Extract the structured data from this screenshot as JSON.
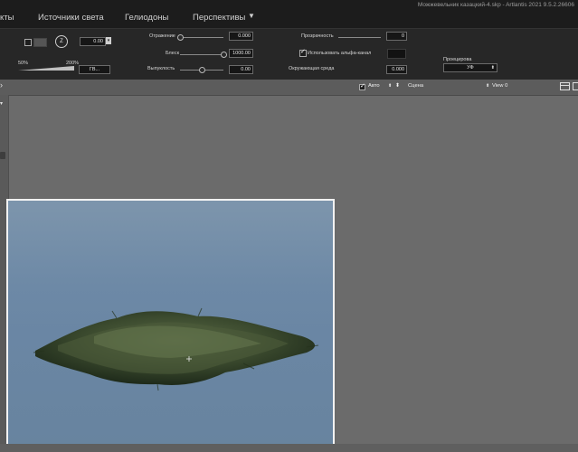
{
  "app": {
    "title": "Можжевельник казацкий-4.skp - Artlantis 2021 9.5.2.26606"
  },
  "menu": {
    "tabs": [
      {
        "label": "кты"
      },
      {
        "label": "Источники света"
      },
      {
        "label": "Гелиодоны"
      },
      {
        "label": "Перспективы"
      }
    ],
    "dropdown_glyph": "▼"
  },
  "panel": {
    "focal_letter": "Z",
    "focal_value": "0.00",
    "scale_min": "50%",
    "scale_max": "200%",
    "scale_button": "ГВ...",
    "reflection": {
      "label": "Отражение",
      "value": "0.000",
      "level": 0.0
    },
    "shine": {
      "label": "Блеск",
      "value": "1000.00",
      "level": 1.0
    },
    "bump": {
      "label": "Выпуклость",
      "value": "0.00",
      "level": 0.5
    },
    "transparency": {
      "label": "Прозрачность",
      "value": "0"
    },
    "alpha": {
      "label": "Использовать альфа-канал",
      "checked": true
    },
    "environment": {
      "label": "Окружающая среда",
      "value": "0.000"
    },
    "projection": {
      "label": "Проецирова",
      "value": "УФ"
    }
  },
  "viewport_toolbar": {
    "auto_label": "Авто",
    "auto_checked": true,
    "scene_label": "Сцена",
    "view_label": "View 0"
  },
  "colors": {
    "menubar": "#1c1c1c",
    "panel": "#272727",
    "workspace": "#6b6b6b",
    "sky": "#6d89a6",
    "foliage": "#3a4a2c"
  },
  "icons": [
    "chevron-right-icon",
    "chevron-left-icon",
    "focal-dial-icon",
    "stepper-icon",
    "updown-arrows-icon",
    "window-icon",
    "layout-icon"
  ]
}
